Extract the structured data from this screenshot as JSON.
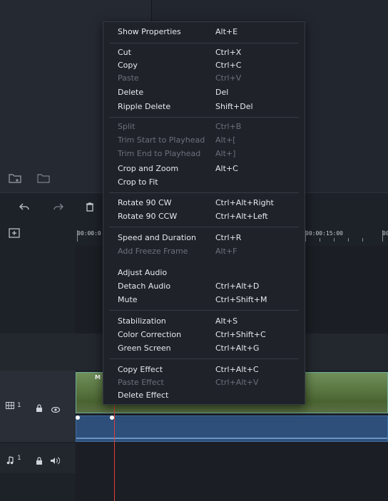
{
  "menu": {
    "show_properties": {
      "label": "Show Properties",
      "shortcut": "Alt+E",
      "enabled": true
    },
    "cut": {
      "label": "Cut",
      "shortcut": "Ctrl+X",
      "enabled": true
    },
    "copy": {
      "label": "Copy",
      "shortcut": "Ctrl+C",
      "enabled": true
    },
    "paste": {
      "label": "Paste",
      "shortcut": "Ctrl+V",
      "enabled": false
    },
    "delete": {
      "label": "Delete",
      "shortcut": "Del",
      "enabled": true
    },
    "ripple_delete": {
      "label": "Ripple Delete",
      "shortcut": "Shift+Del",
      "enabled": true
    },
    "split": {
      "label": "Split",
      "shortcut": "Ctrl+B",
      "enabled": false
    },
    "trim_start": {
      "label": "Trim Start to Playhead",
      "shortcut": "Alt+[",
      "enabled": false
    },
    "trim_end": {
      "label": "Trim End to Playhead",
      "shortcut": "Alt+]",
      "enabled": false
    },
    "crop_zoom": {
      "label": "Crop and Zoom",
      "shortcut": "Alt+C",
      "enabled": true
    },
    "crop_fit": {
      "label": "Crop to Fit",
      "shortcut": "",
      "enabled": true
    },
    "rotate_cw": {
      "label": "Rotate 90 CW",
      "shortcut": "Ctrl+Alt+Right",
      "enabled": true
    },
    "rotate_ccw": {
      "label": "Rotate 90 CCW",
      "shortcut": "Ctrl+Alt+Left",
      "enabled": true
    },
    "speed": {
      "label": "Speed and Duration",
      "shortcut": "Ctrl+R",
      "enabled": true
    },
    "freeze": {
      "label": "Add Freeze Frame",
      "shortcut": "Alt+F",
      "enabled": false
    },
    "adjust_audio": {
      "label": "Adjust Audio",
      "shortcut": "",
      "enabled": true
    },
    "detach_audio": {
      "label": "Detach Audio",
      "shortcut": "Ctrl+Alt+D",
      "enabled": true
    },
    "mute": {
      "label": "Mute",
      "shortcut": "Ctrl+Shift+M",
      "enabled": true
    },
    "stabilization": {
      "label": "Stabilization",
      "shortcut": "Alt+S",
      "enabled": true
    },
    "color_correction": {
      "label": "Color Correction",
      "shortcut": "Ctrl+Shift+C",
      "enabled": true
    },
    "green_screen": {
      "label": "Green Screen",
      "shortcut": "Ctrl+Alt+G",
      "enabled": true
    },
    "copy_effect": {
      "label": "Copy Effect",
      "shortcut": "Ctrl+Alt+C",
      "enabled": true
    },
    "paste_effect": {
      "label": "Paste Effect",
      "shortcut": "Ctrl+Alt+V",
      "enabled": false
    },
    "delete_effect": {
      "label": "Delete Effect",
      "shortcut": "",
      "enabled": true
    }
  },
  "timeline": {
    "time_start": "00:00:0",
    "time_15": "00:00:15:00",
    "time_end": "00",
    "clip_label": "M",
    "video_track_num": "1",
    "audio_track_num": "1"
  },
  "colors": {
    "playhead": "#e0403a",
    "clip_border": "#6fae9a",
    "audio_fill": "#2d4f7a"
  }
}
